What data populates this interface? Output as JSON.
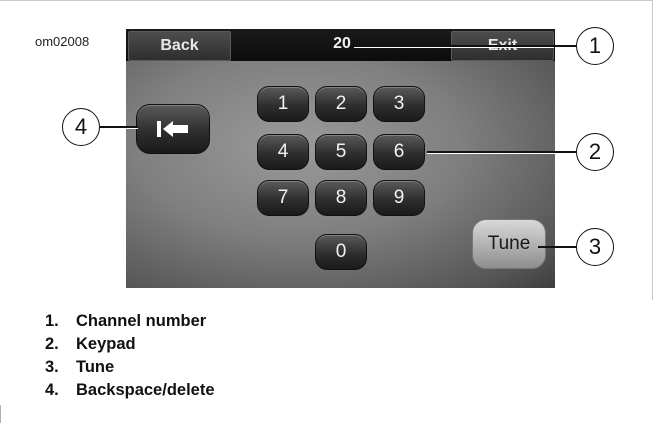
{
  "figure_id": "om02008",
  "screen": {
    "back_label": "Back",
    "exit_label": "Exit",
    "channel_number": "20",
    "keypad": [
      "1",
      "2",
      "3",
      "4",
      "5",
      "6",
      "7",
      "8",
      "9",
      "0"
    ],
    "backspace_icon": "backspace-arrow-icon",
    "tune_label": "Tune"
  },
  "callouts": [
    "1",
    "2",
    "3",
    "4"
  ],
  "legend": [
    {
      "num": "1.",
      "label": "Channel number"
    },
    {
      "num": "2.",
      "label": "Keypad"
    },
    {
      "num": "3.",
      "label": "Tune"
    },
    {
      "num": "4.",
      "label": "Backspace/delete"
    }
  ]
}
